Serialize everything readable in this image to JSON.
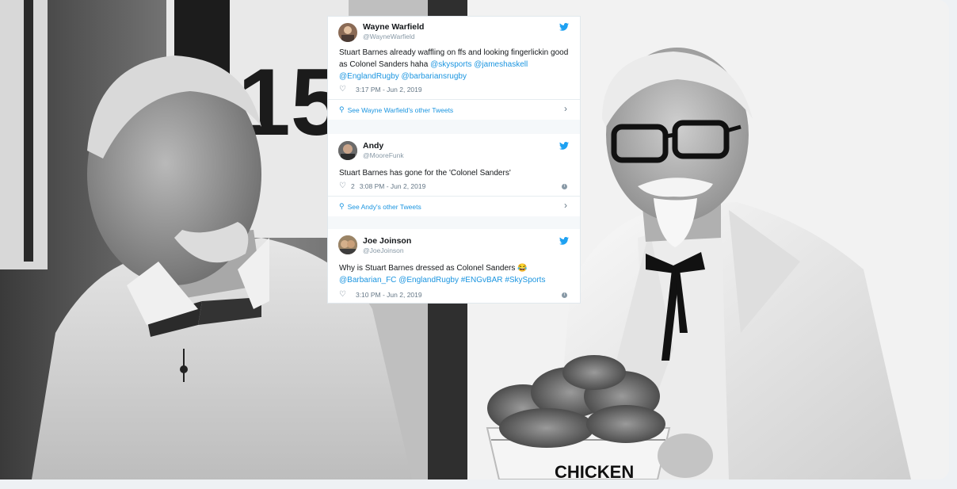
{
  "tweets": [
    {
      "author": "Wayne Warfield",
      "handle": "@WayneWarfield",
      "text_plain": "Stuart Barnes already waffling on ffs and looking fingerlickin good as Colonel Sanders haha",
      "mentions": [
        "@skysports",
        "@jameshaskell",
        "@EnglandRugby",
        "@barbariansrugby"
      ],
      "likes": "",
      "timestamp": "3:17 PM - Jun 2, 2019",
      "see_more": "See Wayne Warfield's other Tweets"
    },
    {
      "author": "Andy",
      "handle": "@MooreFunk",
      "text_plain": "Stuart Barnes has gone for the 'Colonel Sanders'",
      "mentions": [],
      "likes": "2",
      "timestamp": "3:08 PM - Jun 2, 2019",
      "see_more": "See Andy's other Tweets"
    },
    {
      "author": "Joe Joinson",
      "handle": "@JoeJoinson",
      "text_plain": "Why is Stuart Barnes dressed as Colonel Sanders 😂",
      "mentions": [
        "@Barbarian_FC",
        "@EnglandRugby",
        "#ENGvBAR",
        "#SkySports"
      ],
      "likes": "",
      "timestamp": "3:10 PM - Jun 2, 2019",
      "see_more": ""
    }
  ],
  "icons": {
    "bird": "twitter-bird-icon",
    "heart": "heart-icon",
    "info": "info-icon",
    "chevron": "chevron-right-icon"
  },
  "colors": {
    "link": "#1b95e0",
    "text": "#14171a",
    "muted": "#657786"
  },
  "photos": {
    "bucket_label": "CHICKEN"
  }
}
